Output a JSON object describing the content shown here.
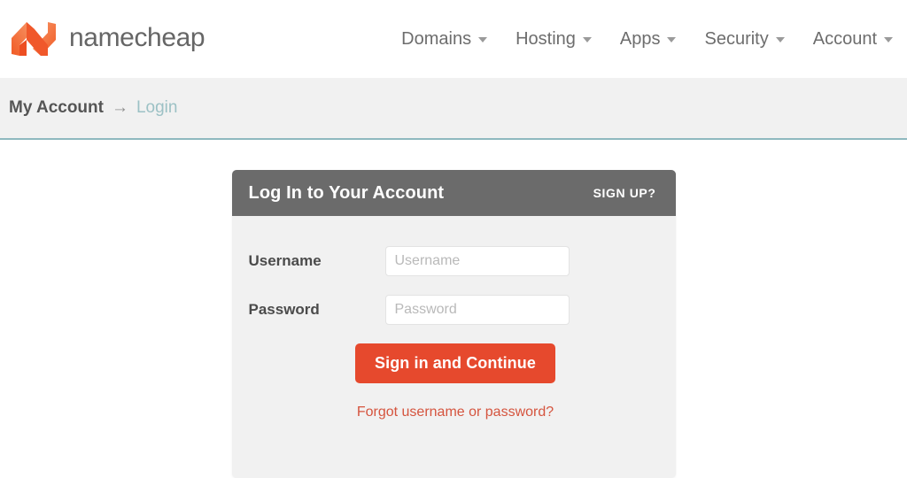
{
  "header": {
    "brand_name": "namecheap",
    "logo_icon": "namecheap-n-logo",
    "nav": [
      {
        "label": "Domains",
        "caret": "chevron-down-icon"
      },
      {
        "label": "Hosting",
        "caret": "chevron-down-icon"
      },
      {
        "label": "Apps",
        "caret": "chevron-down-icon"
      },
      {
        "label": "Security",
        "caret": "chevron-down-icon"
      },
      {
        "label": "Account",
        "caret": "chevron-down-icon"
      }
    ]
  },
  "breadcrumb": {
    "current": "My Account",
    "separator": "→",
    "link": "Login"
  },
  "login_panel": {
    "title": "Log In to Your Account",
    "signup_label": "SIGN UP?",
    "fields": [
      {
        "label": "Username",
        "placeholder": "Username",
        "value": "",
        "type": "text"
      },
      {
        "label": "Password",
        "placeholder": "Password",
        "value": "",
        "type": "password"
      }
    ],
    "submit_label": "Sign in and Continue",
    "forgot_label": "Forgot username or password?"
  },
  "colors": {
    "brand_orange": "#F26B38",
    "brand_orange_dark": "#F05A28",
    "panel_header_gray": "#6B6B6B",
    "panel_body_gray": "#F1F1F1",
    "button_red": "#E6492D",
    "link_red": "#D5543E",
    "breadcrumb_link_teal": "#9CC1C5",
    "breadcrumb_border_teal": "#8FB9BF"
  }
}
